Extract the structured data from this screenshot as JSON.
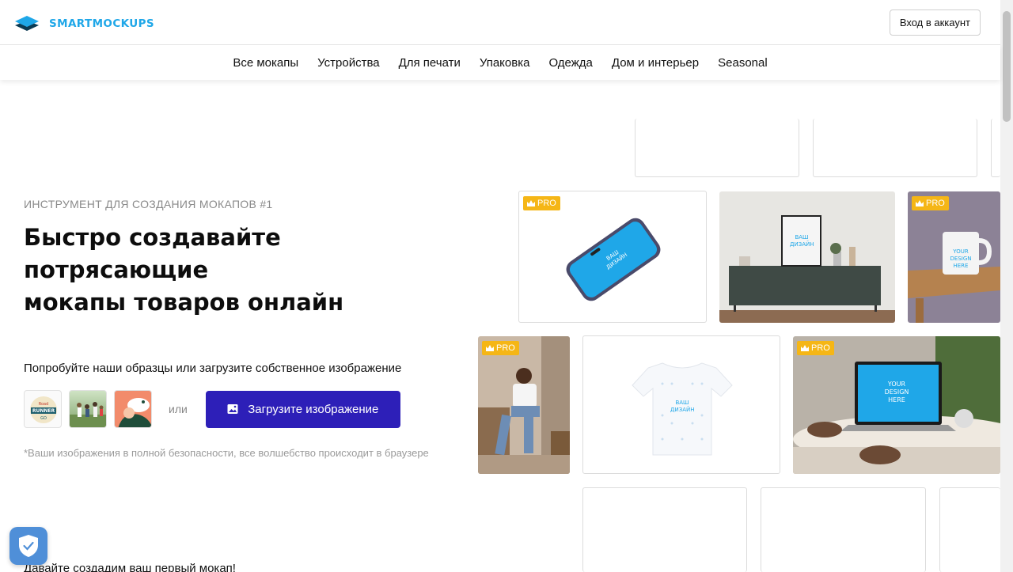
{
  "header": {
    "logo_text": "SMARTMOCKUPS",
    "login_label": "Вход в аккаунт"
  },
  "nav": {
    "items": [
      "Все мокапы",
      "Устройства",
      "Для печати",
      "Упаковка",
      "Одежда",
      "Дом и интерьер",
      "Seasonal"
    ]
  },
  "hero": {
    "eyebrow": "ИНСТРУМЕНТ ДЛЯ СОЗДАНИЯ МОКАПОВ #1",
    "headline_lines": [
      "Быстро создавайте",
      "потрясающие",
      "мокапы товаров онлайн"
    ],
    "try_text": "Попробуйте наши образцы или загрузите собственное изображение",
    "sample_thumbs": [
      "Road Runner Go",
      "Family photo",
      "Illustration"
    ],
    "road_runner_text": "ROAD RUNNER GO",
    "or_label": "или",
    "upload_label": "Загрузите изображение",
    "note": "*Ваши изображения в полной безопасности, все волшебство происходит в браузере",
    "bottom_text": "Давайте создадим ваш первый мокап!"
  },
  "tiles": {
    "pro_label": "PRO",
    "phone_text": "ВАШ ДИЗАЙН",
    "frame_text": "ВАШ ДИЗАЙН",
    "mug_text": "YOUR DESIGN HERE",
    "tshirt_text": "ВАШ ДИЗАЙН",
    "laptop_text": "YOUR DESIGN HERE"
  },
  "colors": {
    "brand": "#1fa7e8",
    "upload_button": "#2d1fb8",
    "pro_badge": "#f5b616",
    "screen_blue": "#1fa7e8"
  }
}
